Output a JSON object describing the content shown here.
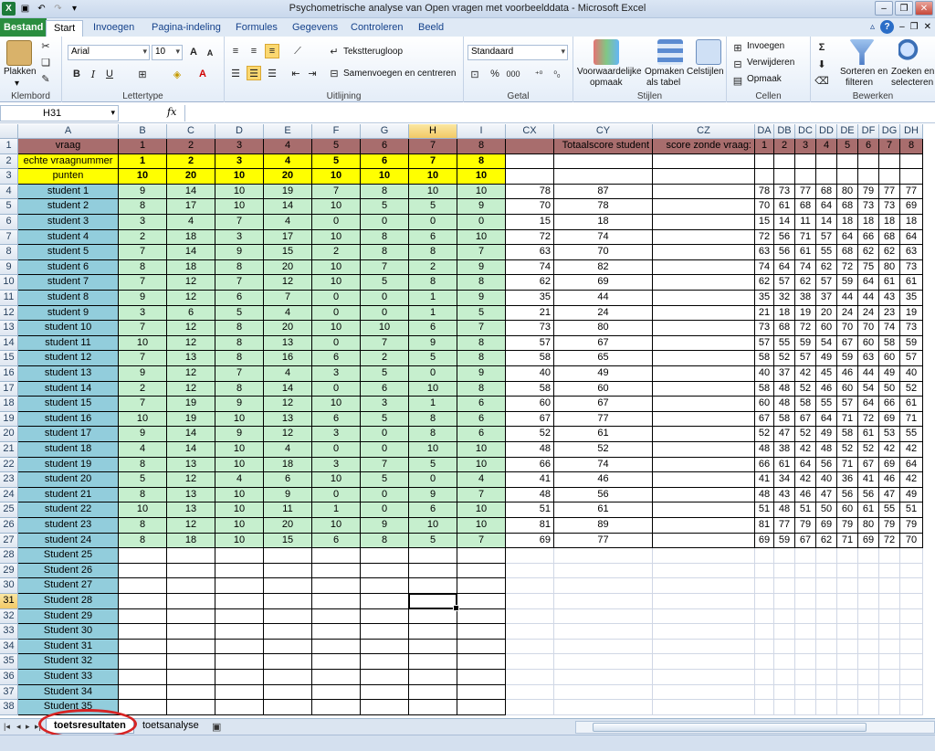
{
  "window": {
    "title": "Psychometrische analyse van Open vragen met voorbeelddata  -  Microsoft Excel"
  },
  "ribbon_tabs": [
    "Bestand",
    "Start",
    "Invoegen",
    "Pagina-indeling",
    "Formules",
    "Gegevens",
    "Controleren",
    "Beeld"
  ],
  "ribbon": {
    "clipboard": {
      "paste": "Plakken",
      "label": "Klembord"
    },
    "font": {
      "name": "Arial",
      "size": "10",
      "label": "Lettertype"
    },
    "alignment": {
      "wrap": "Tekstterugloop",
      "merge": "Samenvoegen en centreren",
      "label": "Uitlijning"
    },
    "number": {
      "format": "Standaard",
      "label": "Getal"
    },
    "styles": {
      "conditional_l1": "Voorwaardelijke",
      "conditional_l2": "opmaak",
      "table_l1": "Opmaken",
      "table_l2": "als tabel",
      "cell_styles": "Celstijlen",
      "label": "Stijlen"
    },
    "cells": {
      "insert": "Invoegen",
      "delete": "Verwijderen",
      "format": "Opmaak",
      "label": "Cellen"
    },
    "editing": {
      "sort_l1": "Sorteren en",
      "sort_l2": "filteren",
      "find_l1": "Zoeken en",
      "find_l2": "selecteren",
      "label": "Bewerken"
    }
  },
  "formula_bar": {
    "namebox": "H31",
    "fx": "fx",
    "formula": ""
  },
  "columns": [
    "A",
    "B",
    "C",
    "D",
    "E",
    "F",
    "G",
    "H",
    "I",
    "CX",
    "CY",
    "CZ",
    "DA",
    "DB",
    "DC",
    "DD",
    "DE",
    "DF",
    "DG",
    "DH"
  ],
  "header_rows": {
    "vraag": {
      "label": "vraag",
      "values": [
        "1",
        "2",
        "3",
        "4",
        "5",
        "6",
        "7",
        "8"
      ],
      "cy": "Totaalscore student",
      "cz": "score zonde vraag:",
      "da_dh": [
        "1",
        "2",
        "3",
        "4",
        "5",
        "6",
        "7",
        "8"
      ]
    },
    "echte": {
      "label": "echte vraagnummer",
      "values": [
        "1",
        "2",
        "3",
        "4",
        "5",
        "6",
        "7",
        "8"
      ]
    },
    "punten": {
      "label": "punten",
      "values": [
        "10",
        "20",
        "10",
        "20",
        "10",
        "10",
        "10",
        "10"
      ]
    }
  },
  "students": [
    {
      "name": "student 1",
      "s": [
        "9",
        "14",
        "10",
        "19",
        "7",
        "8",
        "10",
        "10"
      ],
      "cx": "78",
      "cy": "87",
      "d": [
        "78",
        "73",
        "77",
        "68",
        "80",
        "79",
        "77",
        "77"
      ]
    },
    {
      "name": "student 2",
      "s": [
        "8",
        "17",
        "10",
        "14",
        "10",
        "5",
        "5",
        "9"
      ],
      "cx": "70",
      "cy": "78",
      "d": [
        "70",
        "61",
        "68",
        "64",
        "68",
        "73",
        "73",
        "69"
      ]
    },
    {
      "name": "student 3",
      "s": [
        "3",
        "4",
        "7",
        "4",
        "0",
        "0",
        "0",
        "0"
      ],
      "cx": "15",
      "cy": "18",
      "d": [
        "15",
        "14",
        "11",
        "14",
        "18",
        "18",
        "18",
        "18"
      ]
    },
    {
      "name": "student 4",
      "s": [
        "2",
        "18",
        "3",
        "17",
        "10",
        "8",
        "6",
        "10"
      ],
      "cx": "72",
      "cy": "74",
      "d": [
        "72",
        "56",
        "71",
        "57",
        "64",
        "66",
        "68",
        "64"
      ]
    },
    {
      "name": "student 5",
      "s": [
        "7",
        "14",
        "9",
        "15",
        "2",
        "8",
        "8",
        "7"
      ],
      "cx": "63",
      "cy": "70",
      "d": [
        "63",
        "56",
        "61",
        "55",
        "68",
        "62",
        "62",
        "63"
      ]
    },
    {
      "name": "student 6",
      "s": [
        "8",
        "18",
        "8",
        "20",
        "10",
        "7",
        "2",
        "9"
      ],
      "cx": "74",
      "cy": "82",
      "d": [
        "74",
        "64",
        "74",
        "62",
        "72",
        "75",
        "80",
        "73"
      ]
    },
    {
      "name": "student 7",
      "s": [
        "7",
        "12",
        "7",
        "12",
        "10",
        "5",
        "8",
        "8"
      ],
      "cx": "62",
      "cy": "69",
      "d": [
        "62",
        "57",
        "62",
        "57",
        "59",
        "64",
        "61",
        "61"
      ]
    },
    {
      "name": "student 8",
      "s": [
        "9",
        "12",
        "6",
        "7",
        "0",
        "0",
        "1",
        "9"
      ],
      "cx": "35",
      "cy": "44",
      "d": [
        "35",
        "32",
        "38",
        "37",
        "44",
        "44",
        "43",
        "35"
      ]
    },
    {
      "name": "student 9",
      "s": [
        "3",
        "6",
        "5",
        "4",
        "0",
        "0",
        "1",
        "5"
      ],
      "cx": "21",
      "cy": "24",
      "d": [
        "21",
        "18",
        "19",
        "20",
        "24",
        "24",
        "23",
        "19"
      ]
    },
    {
      "name": "student 10",
      "s": [
        "7",
        "12",
        "8",
        "20",
        "10",
        "10",
        "6",
        "7"
      ],
      "cx": "73",
      "cy": "80",
      "d": [
        "73",
        "68",
        "72",
        "60",
        "70",
        "70",
        "74",
        "73"
      ]
    },
    {
      "name": "student 11",
      "s": [
        "10",
        "12",
        "8",
        "13",
        "0",
        "7",
        "9",
        "8"
      ],
      "cx": "57",
      "cy": "67",
      "d": [
        "57",
        "55",
        "59",
        "54",
        "67",
        "60",
        "58",
        "59"
      ]
    },
    {
      "name": "student 12",
      "s": [
        "7",
        "13",
        "8",
        "16",
        "6",
        "2",
        "5",
        "8"
      ],
      "cx": "58",
      "cy": "65",
      "d": [
        "58",
        "52",
        "57",
        "49",
        "59",
        "63",
        "60",
        "57"
      ]
    },
    {
      "name": "student 13",
      "s": [
        "9",
        "12",
        "7",
        "4",
        "3",
        "5",
        "0",
        "9"
      ],
      "cx": "40",
      "cy": "49",
      "d": [
        "40",
        "37",
        "42",
        "45",
        "46",
        "44",
        "49",
        "40"
      ]
    },
    {
      "name": "student 14",
      "s": [
        "2",
        "12",
        "8",
        "14",
        "0",
        "6",
        "10",
        "8"
      ],
      "cx": "58",
      "cy": "60",
      "d": [
        "58",
        "48",
        "52",
        "46",
        "60",
        "54",
        "50",
        "52"
      ]
    },
    {
      "name": "student 15",
      "s": [
        "7",
        "19",
        "9",
        "12",
        "10",
        "3",
        "1",
        "6"
      ],
      "cx": "60",
      "cy": "67",
      "d": [
        "60",
        "48",
        "58",
        "55",
        "57",
        "64",
        "66",
        "61"
      ]
    },
    {
      "name": "student 16",
      "s": [
        "10",
        "19",
        "10",
        "13",
        "6",
        "5",
        "8",
        "6"
      ],
      "cx": "67",
      "cy": "77",
      "d": [
        "67",
        "58",
        "67",
        "64",
        "71",
        "72",
        "69",
        "71"
      ]
    },
    {
      "name": "student 17",
      "s": [
        "9",
        "14",
        "9",
        "12",
        "3",
        "0",
        "8",
        "6"
      ],
      "cx": "52",
      "cy": "61",
      "d": [
        "52",
        "47",
        "52",
        "49",
        "58",
        "61",
        "53",
        "55"
      ]
    },
    {
      "name": "student 18",
      "s": [
        "4",
        "14",
        "10",
        "4",
        "0",
        "0",
        "10",
        "10"
      ],
      "cx": "48",
      "cy": "52",
      "d": [
        "48",
        "38",
        "42",
        "48",
        "52",
        "52",
        "42",
        "42"
      ]
    },
    {
      "name": "student 19",
      "s": [
        "8",
        "13",
        "10",
        "18",
        "3",
        "7",
        "5",
        "10"
      ],
      "cx": "66",
      "cy": "74",
      "d": [
        "66",
        "61",
        "64",
        "56",
        "71",
        "67",
        "69",
        "64"
      ]
    },
    {
      "name": "student 20",
      "s": [
        "5",
        "12",
        "4",
        "6",
        "10",
        "5",
        "0",
        "4"
      ],
      "cx": "41",
      "cy": "46",
      "d": [
        "41",
        "34",
        "42",
        "40",
        "36",
        "41",
        "46",
        "42"
      ]
    },
    {
      "name": "student 21",
      "s": [
        "8",
        "13",
        "10",
        "9",
        "0",
        "0",
        "9",
        "7"
      ],
      "cx": "48",
      "cy": "56",
      "d": [
        "48",
        "43",
        "46",
        "47",
        "56",
        "56",
        "47",
        "49"
      ]
    },
    {
      "name": "student 22",
      "s": [
        "10",
        "13",
        "10",
        "11",
        "1",
        "0",
        "6",
        "10"
      ],
      "cx": "51",
      "cy": "61",
      "d": [
        "51",
        "48",
        "51",
        "50",
        "60",
        "61",
        "55",
        "51"
      ]
    },
    {
      "name": "student 23",
      "s": [
        "8",
        "12",
        "10",
        "20",
        "10",
        "9",
        "10",
        "10"
      ],
      "cx": "81",
      "cy": "89",
      "d": [
        "81",
        "77",
        "79",
        "69",
        "79",
        "80",
        "79",
        "79"
      ]
    },
    {
      "name": "student 24",
      "s": [
        "8",
        "18",
        "10",
        "15",
        "6",
        "8",
        "5",
        "7"
      ],
      "cx": "69",
      "cy": "77",
      "d": [
        "69",
        "59",
        "67",
        "62",
        "71",
        "69",
        "72",
        "70"
      ]
    }
  ],
  "empty_students": [
    "Student 25",
    "Student 26",
    "Student 27",
    "Student 28",
    "Student 29",
    "Student 30",
    "Student 31",
    "Student 32",
    "Student 33",
    "Student 34",
    "Student 35"
  ],
  "sheet_tabs": [
    "toetsresultaten",
    "toetsanalyse"
  ],
  "active_sheet": "toetsresultaten",
  "colors": {
    "header_row": "#a86d6d",
    "yellow": "#ffff00",
    "green": "#c6efce",
    "teal": "#92cddc",
    "annotation": "#d62424"
  }
}
